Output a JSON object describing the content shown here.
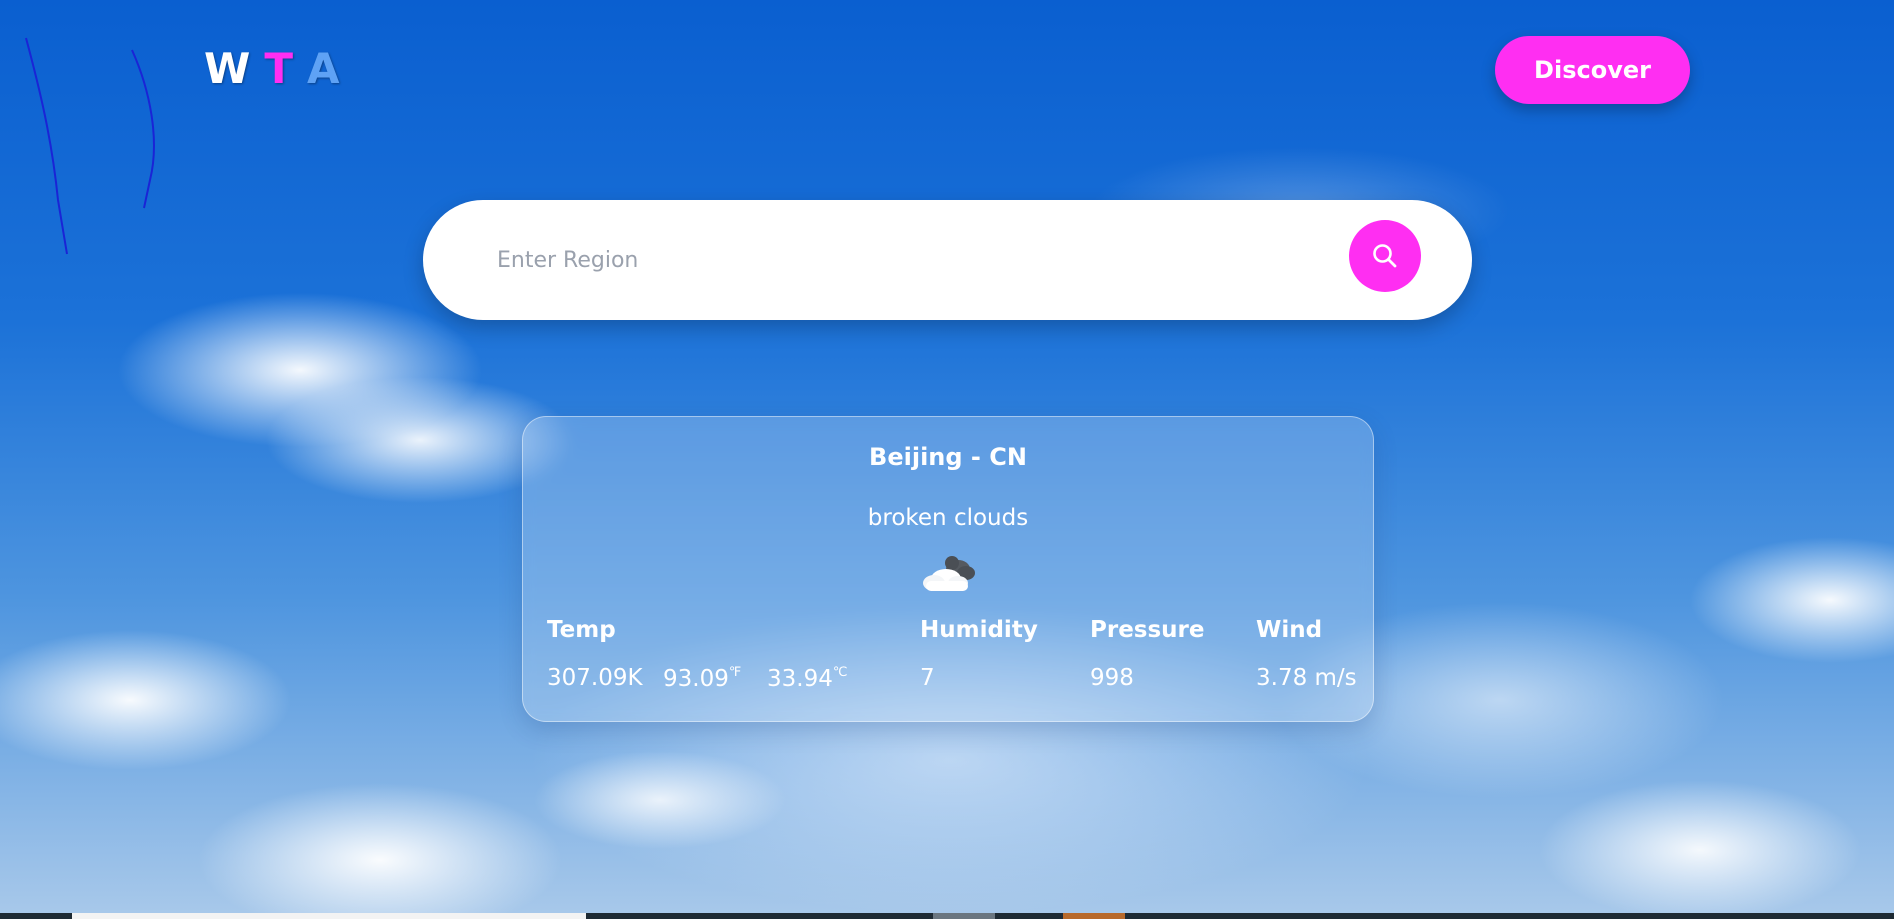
{
  "logo": {
    "letters": [
      "W",
      "T",
      "A"
    ],
    "colors": [
      "#ffffff",
      "#ff2ef2",
      "#5ea2f5"
    ]
  },
  "header": {
    "discover_label": "Discover"
  },
  "search": {
    "placeholder": "Enter Region",
    "value": ""
  },
  "weather": {
    "location": "Beijing - CN",
    "description": "broken clouds",
    "icon": "broken-clouds-icon",
    "labels": {
      "temp": "Temp",
      "humidity": "Humidity",
      "pressure": "Pressure",
      "wind": "Wind"
    },
    "values": {
      "temp_kelvin": "307.09K",
      "temp_fahrenheit": "93.09",
      "fahrenheit_unit": "℉",
      "temp_celsius": "33.94",
      "celsius_unit": "℃",
      "humidity": "7",
      "pressure": "998",
      "wind": "3.78 m/s"
    }
  },
  "colors": {
    "accent": "#ff2ef2",
    "logo_blue": "#5ea2f5",
    "sky_top": "#0a5fd0",
    "taskbar": "#1e2a33"
  }
}
